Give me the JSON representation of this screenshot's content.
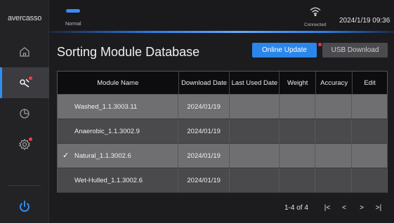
{
  "app": {
    "logo": "avercasso"
  },
  "status": {
    "mode": "Normal",
    "connection": "Connected",
    "datetime": "2024/1/19 09:36"
  },
  "page": {
    "title": "Sorting Module Database"
  },
  "toolbar": {
    "online_update": "Online Update",
    "usb_download": "USB Download"
  },
  "table": {
    "columns": [
      "Module Name",
      "Download Date",
      "Last Used Date",
      "Weight",
      "Accuracy",
      "Edit"
    ],
    "rows": [
      {
        "name": "Washed_1.1.3003.11",
        "download_date": "2024/01/19",
        "selected": false
      },
      {
        "name": "Anaerobic_1.1.3002.9",
        "download_date": "2024/01/19",
        "selected": false
      },
      {
        "name": "Natural_1.1.3002.6",
        "download_date": "2024/01/19",
        "selected": true
      },
      {
        "name": "Wet-Hulled_1.1.3002.6",
        "download_date": "2024/01/19",
        "selected": false
      }
    ]
  },
  "pagination": {
    "range_text": "1-4 of 4",
    "first": "|<",
    "prev": "<",
    "next": ">",
    "last": ">|"
  },
  "icons": {
    "home": "home-icon",
    "sort": "sort-module-icon",
    "stats": "pie-chart-icon",
    "settings": "gear-icon",
    "power": "power-icon",
    "wifi": "wifi-icon",
    "check": "check-icon"
  },
  "colors": {
    "accent": "#2b86ea",
    "alert": "#ff3040",
    "power": "#2f8ef2"
  }
}
